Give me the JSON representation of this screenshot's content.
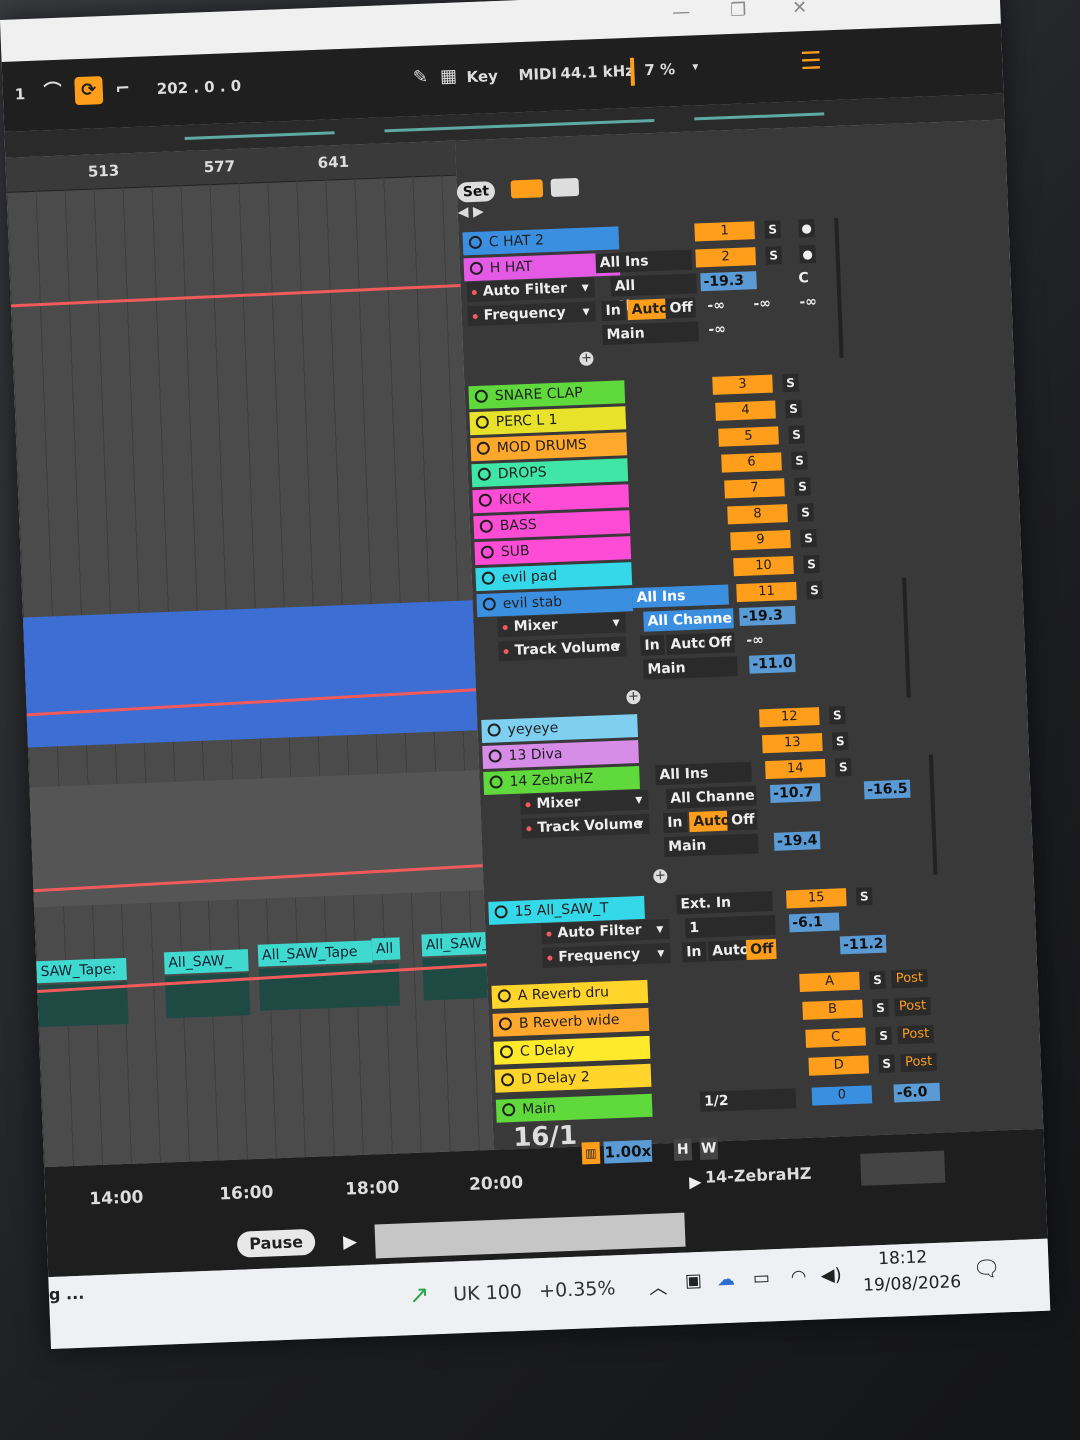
{
  "window": {
    "minimize": "—",
    "maximize": "❐",
    "close": "✕"
  },
  "toolbar": {
    "loop_num": "1",
    "position": "202 . 0 . 0",
    "key_label": "Key",
    "midi_label": "MIDI",
    "sample_rate": "44.1 kHz",
    "cpu": "7 %"
  },
  "ruler": [
    "513",
    "577",
    "641"
  ],
  "clips": [
    "SAW_Tape:",
    "All_SAW_",
    "All_SAW_Tape",
    "All",
    "All_SAW_Tape"
  ],
  "session": {
    "set_label": "Set"
  },
  "tracks": [
    {
      "name": "C HAT 2",
      "color": "#3b8fe0",
      "num": "1"
    },
    {
      "name": "H HAT",
      "color": "#e55ae5",
      "num": "2"
    },
    {
      "name": "SNARE CLAP",
      "color": "#5fd93b",
      "num": "3"
    },
    {
      "name": "PERC L 1",
      "color": "#e8e22b",
      "num": "4"
    },
    {
      "name": "MOD DRUMS",
      "color": "#ffa82b",
      "num": "5"
    },
    {
      "name": "DROPS",
      "color": "#3fe6a6",
      "num": "6"
    },
    {
      "name": "KICK",
      "color": "#ff4cd6",
      "num": "7"
    },
    {
      "name": "BASS",
      "color": "#ff4cd6",
      "num": "8"
    },
    {
      "name": "SUB",
      "color": "#ff4cd6",
      "num": "9"
    },
    {
      "name": "evil pad",
      "color": "#35d8e8",
      "num": "10"
    },
    {
      "name": "evil stab",
      "color": "#3b8fe0",
      "num": "11"
    },
    {
      "name": "yeyeye",
      "color": "#7fcff0",
      "num": "12"
    },
    {
      "name": "13 Diva",
      "color": "#d78ce8",
      "num": "13"
    },
    {
      "name": "14 ZebraHZ",
      "color": "#5fd93b",
      "num": "14"
    },
    {
      "name": "15 All_SAW_T",
      "color": "#35d8e8",
      "num": "15"
    },
    {
      "name": "A Reverb dru",
      "color": "#ffd42b",
      "num": "A"
    },
    {
      "name": "B Reverb wide",
      "color": "#ffa82b",
      "num": "B"
    },
    {
      "name": "C Delay",
      "color": "#ffe92b",
      "num": "C"
    },
    {
      "name": "D Delay 2",
      "color": "#ffd42b",
      "num": "D"
    },
    {
      "name": "Main",
      "color": "#5fd93b",
      "num": "0"
    }
  ],
  "devices": {
    "hhat": [
      "Auto Filter",
      "Frequency"
    ],
    "evilstab": [
      "Mixer",
      "Track Volume"
    ],
    "zebra": [
      "Mixer",
      "Track Volume"
    ],
    "allsaw": [
      "Auto Filter",
      "Frequency"
    ]
  },
  "io": {
    "all_ins": "All Ins",
    "all_channels": "All Channe",
    "in": "In",
    "auto": "Auto",
    "off": "Off",
    "main": "Main",
    "ext_in": "Ext. In",
    "ch1": "1",
    "half": "1/2"
  },
  "values": {
    "hhat_vol": "-19.3",
    "hhat_c": "C",
    "neg_inf": "-∞",
    "evil_vol": "-19.3",
    "evil_send": "-11.0",
    "zebra_vol": "-10.7",
    "zebra_send": "-16.5",
    "zebra_send2": "-19.4",
    "saw_vol": "-6.1",
    "saw_pan": "-11.2",
    "main_vol": "-6.0",
    "post": "Post",
    "s": "S"
  },
  "transport": {
    "position": "16/1",
    "tempo": "1.00x",
    "h": "H",
    "w": "W",
    "pause": "Pause",
    "track_name": "14-ZebraHZ"
  },
  "timeline": [
    "14:00",
    "16:00",
    "18:00",
    "20:00"
  ],
  "taskbar": {
    "ticker": "UK 100",
    "change": "+0.35%",
    "time": "18:12",
    "date": "19/08/2026",
    "ellipsis": "g ..."
  }
}
